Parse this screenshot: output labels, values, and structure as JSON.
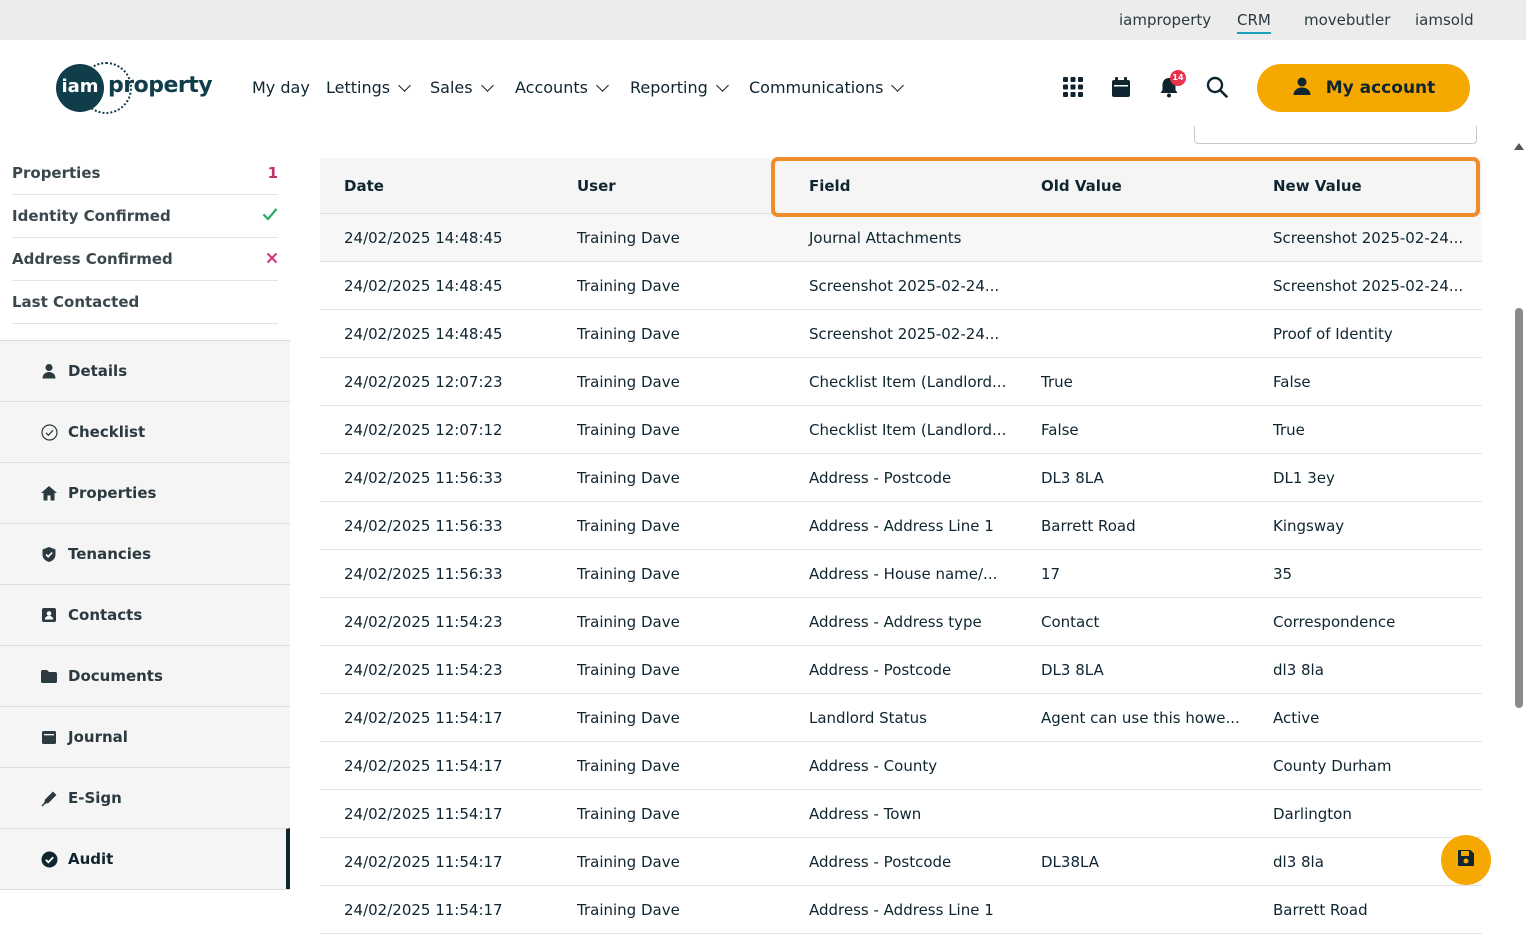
{
  "topbar": {
    "links": [
      "iamproperty",
      "CRM",
      "movebutler",
      "iamsold"
    ],
    "active": "CRM"
  },
  "logo": {
    "circle_text": "iam",
    "word": "property"
  },
  "nav": [
    {
      "label": "My day",
      "has_dropdown": false
    },
    {
      "label": "Lettings",
      "has_dropdown": true
    },
    {
      "label": "Sales",
      "has_dropdown": true
    },
    {
      "label": "Accounts",
      "has_dropdown": true
    },
    {
      "label": "Reporting",
      "has_dropdown": true
    },
    {
      "label": "Communications",
      "has_dropdown": true
    }
  ],
  "header_icons": [
    "apps-grid-icon",
    "calendar-icon",
    "bell-icon",
    "search-icon"
  ],
  "notifications_count": "14",
  "account_button": "My account",
  "sidebar": {
    "meta": [
      {
        "label": "Properties",
        "value": "1",
        "value_color": "#c0306a"
      },
      {
        "label": "Identity Confirmed",
        "icon": "check-icon",
        "icon_color": "#2aa86a"
      },
      {
        "label": "Address Confirmed",
        "icon": "cross-icon",
        "icon_color": "#d2357a"
      },
      {
        "label": "Last Contacted",
        "value": ""
      }
    ],
    "menu": [
      {
        "label": "Details",
        "icon": "person-icon"
      },
      {
        "label": "Checklist",
        "icon": "check-circle-outline-icon"
      },
      {
        "label": "Properties",
        "icon": "house-icon"
      },
      {
        "label": "Tenancies",
        "icon": "shield-check-icon"
      },
      {
        "label": "Contacts",
        "icon": "contact-card-icon"
      },
      {
        "label": "Documents",
        "icon": "folder-icon"
      },
      {
        "label": "Journal",
        "icon": "journal-icon"
      },
      {
        "label": "E-Sign",
        "icon": "pen-icon"
      },
      {
        "label": "Audit",
        "icon": "check-circle-filled-icon",
        "active": true
      }
    ]
  },
  "table": {
    "columns": [
      "Date",
      "User",
      "Field",
      "Old Value",
      "New Value"
    ],
    "rows": [
      [
        "24/02/2025 14:48:45",
        "Training Dave",
        "Journal Attachments",
        "",
        "Screenshot 2025-02-24..."
      ],
      [
        "24/02/2025 14:48:45",
        "Training Dave",
        "Screenshot 2025-02-24...",
        "",
        "Screenshot 2025-02-24..."
      ],
      [
        "24/02/2025 14:48:45",
        "Training Dave",
        "Screenshot 2025-02-24...",
        "",
        "Proof of Identity"
      ],
      [
        "24/02/2025 12:07:23",
        "Training Dave",
        "Checklist Item (Landlord...",
        "True",
        "False"
      ],
      [
        "24/02/2025 12:07:12",
        "Training Dave",
        "Checklist Item (Landlord...",
        "False",
        "True"
      ],
      [
        "24/02/2025 11:56:33",
        "Training Dave",
        "Address - Postcode",
        "DL3 8LA",
        "DL1 3ey"
      ],
      [
        "24/02/2025 11:56:33",
        "Training Dave",
        "Address - Address Line 1",
        "Barrett Road",
        "Kingsway"
      ],
      [
        "24/02/2025 11:56:33",
        "Training Dave",
        "Address - House name/...",
        "17",
        "35"
      ],
      [
        "24/02/2025 11:54:23",
        "Training Dave",
        "Address - Address type",
        "Contact",
        "Correspondence"
      ],
      [
        "24/02/2025 11:54:23",
        "Training Dave",
        "Address - Postcode",
        "DL3 8LA",
        "dl3 8la"
      ],
      [
        "24/02/2025 11:54:17",
        "Training Dave",
        "Landlord Status",
        "Agent can use this howe...",
        "Active"
      ],
      [
        "24/02/2025 11:54:17",
        "Training Dave",
        "Address - County",
        "",
        "County Durham"
      ],
      [
        "24/02/2025 11:54:17",
        "Training Dave",
        "Address - Town",
        "",
        "Darlington"
      ],
      [
        "24/02/2025 11:54:17",
        "Training Dave",
        "Address - Postcode",
        "DL38LA",
        "dl3 8la"
      ],
      [
        "24/02/2025 11:54:17",
        "Training Dave",
        "Address - Address Line 1",
        "",
        "Barrett Road"
      ]
    ]
  },
  "colors": {
    "accent": "#f5a800",
    "highlight": "#ef8c2c",
    "dark": "#0f3d4a"
  }
}
